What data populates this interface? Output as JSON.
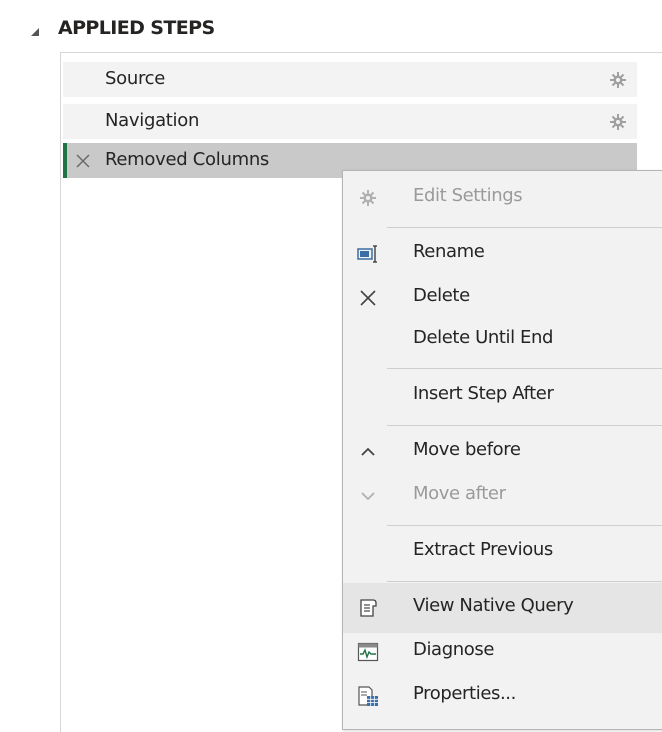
{
  "section": {
    "title": "APPLIED STEPS"
  },
  "steps": [
    {
      "label": "Source",
      "icon": "gear-icon"
    },
    {
      "label": "Navigation",
      "icon": "gear-icon"
    },
    {
      "label": "Removed Columns",
      "icon": "delete-icon",
      "selected": true
    }
  ],
  "menu": {
    "edit_settings": "Edit Settings",
    "rename": "Rename",
    "delete": "Delete",
    "delete_until_end": "Delete Until End",
    "insert_step_after": "Insert Step After",
    "move_before": "Move before",
    "move_after": "Move after",
    "extract_previous": "Extract Previous",
    "view_native_query": "View Native Query",
    "diagnose": "Diagnose",
    "properties": "Properties..."
  },
  "colors": {
    "accent": "#217346",
    "selected_row": "#c9c9c9",
    "menu_bg": "#f2f2f2"
  }
}
